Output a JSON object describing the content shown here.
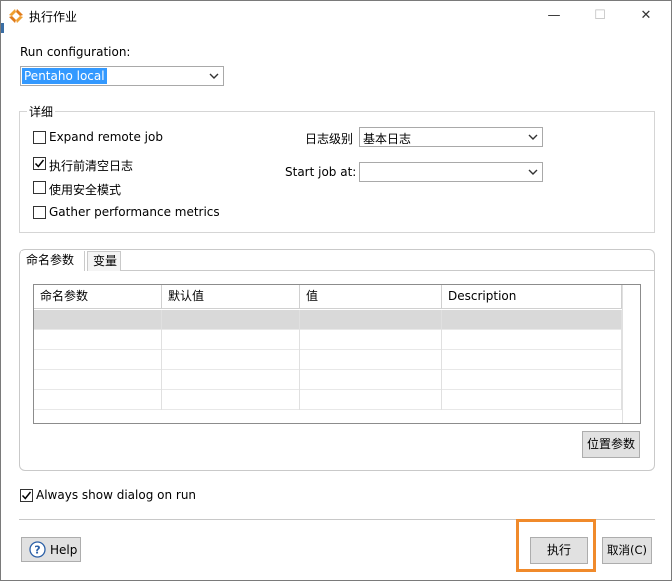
{
  "window": {
    "title": "执行作业",
    "minimize_glyph": "—",
    "maximize_glyph": "☐",
    "close_glyph": "✕"
  },
  "run_configuration": {
    "label": "Run configuration:",
    "value": "Pentaho local"
  },
  "details": {
    "legend": "详细",
    "expand_remote_job": {
      "label": "Expand remote job",
      "checked": false
    },
    "clear_log_before_run": {
      "label": "执行前清空日志",
      "checked": true
    },
    "safe_mode": {
      "label": "使用安全模式",
      "checked": false
    },
    "gather_performance_metrics": {
      "label": "Gather performance metrics",
      "checked": false
    },
    "log_level": {
      "label": "日志级别",
      "value": "基本日志"
    },
    "start_job_at": {
      "label": "Start job at:",
      "value": ""
    }
  },
  "tabs": [
    {
      "label": "命名参数",
      "active": true
    },
    {
      "label": "变量",
      "active": false
    }
  ],
  "parameters_table": {
    "columns": [
      "命名参数",
      "默认值",
      "值",
      "Description"
    ],
    "rows": [
      [
        "",
        "",
        "",
        ""
      ]
    ]
  },
  "position_params_button": "位置参数",
  "always_show_dialog": {
    "label": "Always show dialog on run",
    "checked": true
  },
  "buttons": {
    "help": "Help",
    "run": "执行",
    "cancel": "取消(C)"
  },
  "colors": {
    "highlight": "#f08a2b",
    "selection": "#3399ff"
  }
}
